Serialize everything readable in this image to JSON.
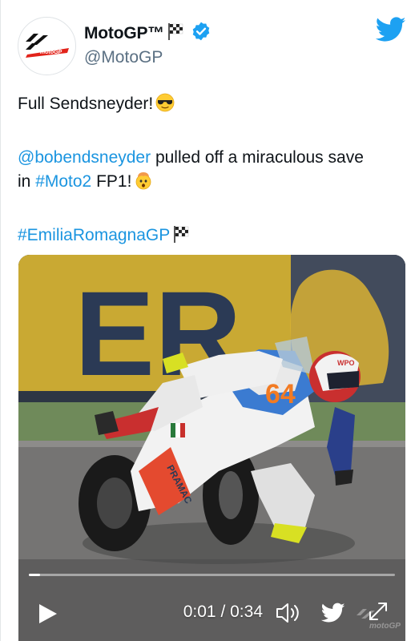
{
  "account": {
    "display_name": "MotoGP™",
    "handle": "@MotoGP",
    "avatar_text": "motoGP"
  },
  "tweet": {
    "line1": "Full Sendsneyder!",
    "mention": "@bobendsneyder",
    "line2_rest": " pulled off a miraculous save",
    "line3_prefix": "in ",
    "hashtag_moto2": "#Moto2",
    "line3_rest": " FP1!",
    "hashtag_event": "#EmiliaRomagnaGP"
  },
  "video": {
    "current_time": "0:01",
    "separator": " / ",
    "duration": "0:34",
    "progress_fraction": 0.03,
    "rider_number": "64",
    "banner_text": "ER",
    "helmet_text": "WPO",
    "fairing_text": "PRAMAC",
    "watermark_text": "motoGP"
  },
  "colors": {
    "link": "#1b95e0",
    "twitter_blue": "#1da1f2",
    "verified": "#1da1f2",
    "brand_red": "#e2231a"
  },
  "icons": {
    "verified": "verified-badge-icon",
    "flag": "checkered-flag-icon",
    "twitter": "twitter-bird-icon",
    "play": "play-icon",
    "volume": "volume-icon",
    "expand": "expand-icon"
  }
}
